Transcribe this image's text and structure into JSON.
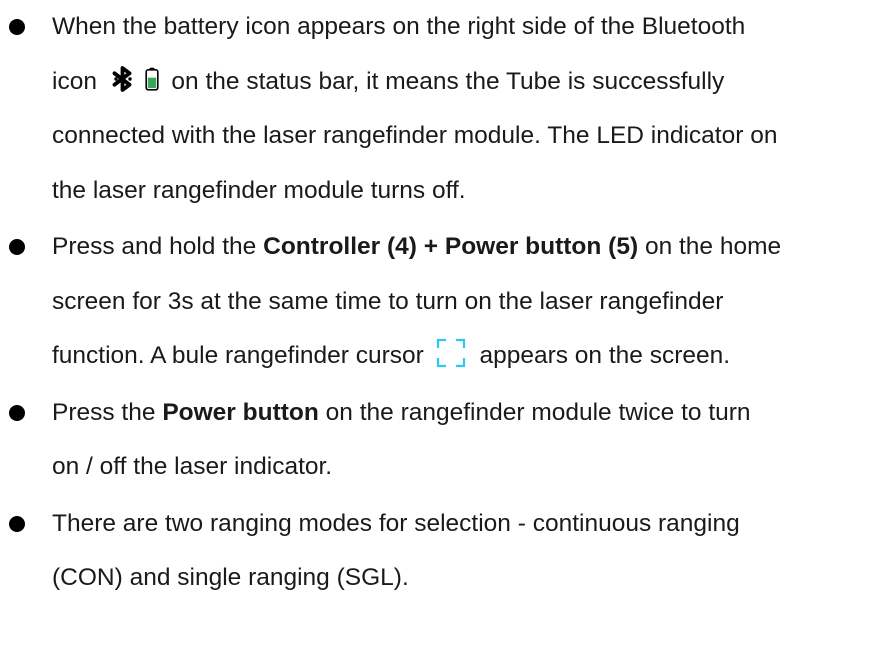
{
  "bullets": [
    {
      "lines": [
        {
          "text": "When the battery icon appears on the right side of the Bluetooth"
        },
        {
          "before": "icon",
          "after": "on the status bar, it means the Tube is successfully"
        },
        {
          "text": "connected with the laser rangefinder module. The LED indicator on"
        },
        {
          "text": "the laser rangefinder module turns off."
        }
      ]
    },
    {
      "lines": [
        {
          "before": "Press and hold the",
          "bold": "Controller (4) + Power button (5)",
          "after": "on the home"
        },
        {
          "text": "screen for 3s at the same time to turn on the laser rangefinder"
        },
        {
          "before": "function. A bule rangefinder cursor",
          "after": "appears on the screen."
        }
      ]
    },
    {
      "lines": [
        {
          "before": "Press the",
          "bold": "Power button",
          "after": "on the rangefinder module twice to turn"
        },
        {
          "text": "on / off the laser indicator."
        }
      ]
    },
    {
      "lines": [
        {
          "text": "There are two ranging modes for selection - continuous ranging"
        },
        {
          "text": "(CON) and single ranging (SGL)."
        }
      ]
    }
  ],
  "icons": {
    "bluetooth": "bluetooth-icon",
    "battery": "battery-icon",
    "cursor": "rangefinder-cursor-icon"
  },
  "colors": {
    "text": "#1a1a1a",
    "bullet": "#000000",
    "battery_fill": "#3aa657",
    "cursor": "#35c6ef"
  }
}
